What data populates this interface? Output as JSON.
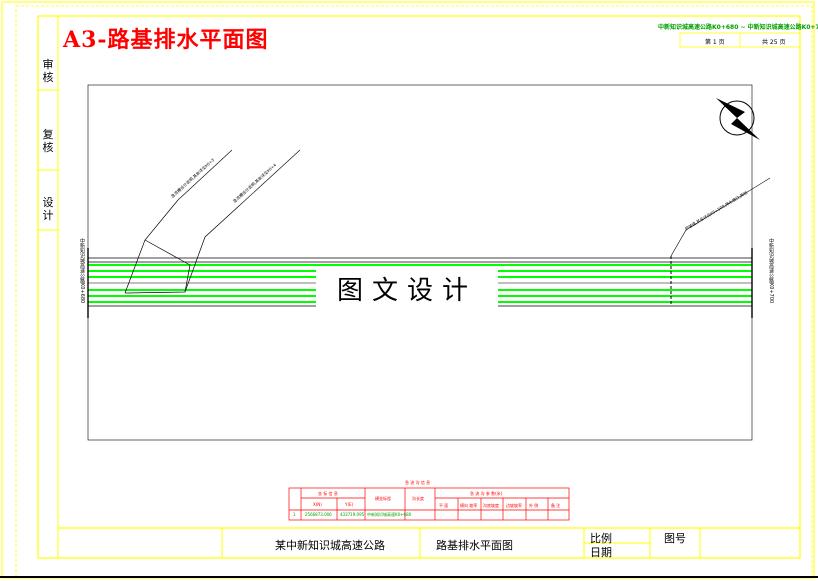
{
  "title": "A3-路基排水平面图",
  "watermark": "图文设计",
  "side_labels": {
    "review": "审核",
    "check": "复核",
    "design": "设计"
  },
  "header": {
    "range": "中新知识城高速公路K0+680 ~ 中新知识城高速公路K0+700",
    "sheet_no": "第 1 页",
    "total": "共 25 页"
  },
  "left_station": "中新知识城高速公路K0+680",
  "right_station": "中新知识城高速公路K0+700",
  "annotations": {
    "left1": "急流槽设计说明,其余详见K0+3",
    "left2": "急流槽设计说明,其余详见K0+4",
    "right": "护坡道,其余详见K0+500,排水坡口,其他"
  },
  "table": {
    "title": "急 流 沟 信 息",
    "col_coord": "坐 标 信 息",
    "col_x": "X(N)",
    "col_y": "Y(E)",
    "col_station": "横坐标程",
    "col_length": "沟长度",
    "col_area": "急 流 沟 参 数(米)",
    "sub_a": "平 面",
    "sub_b": "横向 坡率",
    "sub_c": "沟底坡度",
    "sub_d": "边坡坡率",
    "sub_e": "外 侧",
    "sub_f": "备 注",
    "row_x": "2566873.006",
    "row_y": "433719.095",
    "row_station": "中新知识城高速K0+680",
    "row_label": "1"
  },
  "titleblock": {
    "project": "某中新知识城高速公路",
    "drawing": "路基排水平面图",
    "scale_label": "比例",
    "date_label": "日期",
    "figure_label": "图号"
  },
  "colors": {
    "frame": "#ffff00",
    "title": "#ff0000",
    "road": "#00ff00",
    "table": "#ff0000"
  }
}
